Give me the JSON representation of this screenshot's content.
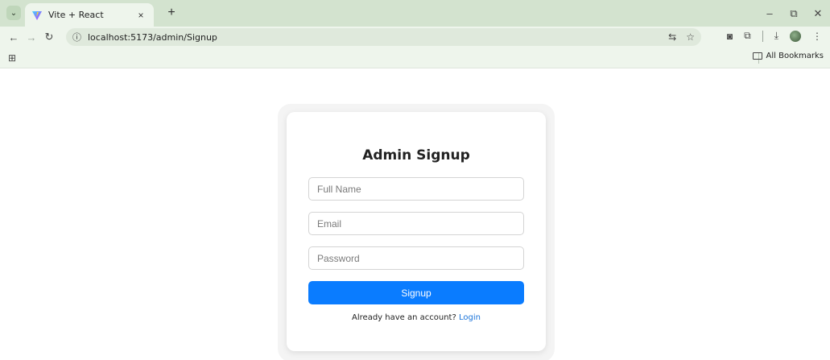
{
  "browser": {
    "tab_title": "Vite + React",
    "tab_close": "×",
    "new_tab": "+",
    "url": "localhost:5173/admin/Signup",
    "bookmarks_label": "All Bookmarks",
    "win_minimize": "–",
    "win_restore": "⧉",
    "win_close": "✕",
    "icons": [
      "tab-search-icon",
      "vite-logo-icon",
      "back-icon",
      "forward-icon",
      "reload-icon",
      "site-info-icon",
      "translate-icon",
      "star-icon",
      "camera-icon",
      "extensions-icon",
      "download-icon",
      "profile-avatar",
      "menu-icon",
      "apps-icon",
      "folder-icon"
    ]
  },
  "signup": {
    "title": "Admin Signup",
    "fullname_placeholder": "Full Name",
    "email_placeholder": "Email",
    "password_placeholder": "Password",
    "button_label": "Signup",
    "login_prompt": "Already have an account?",
    "login_link": "Login"
  },
  "colors": {
    "primary_button": "#0a7cff",
    "link": "#1a73d9",
    "chrome_tabbar": "#d3e3cf",
    "chrome_toolbar": "#eef5ec"
  }
}
